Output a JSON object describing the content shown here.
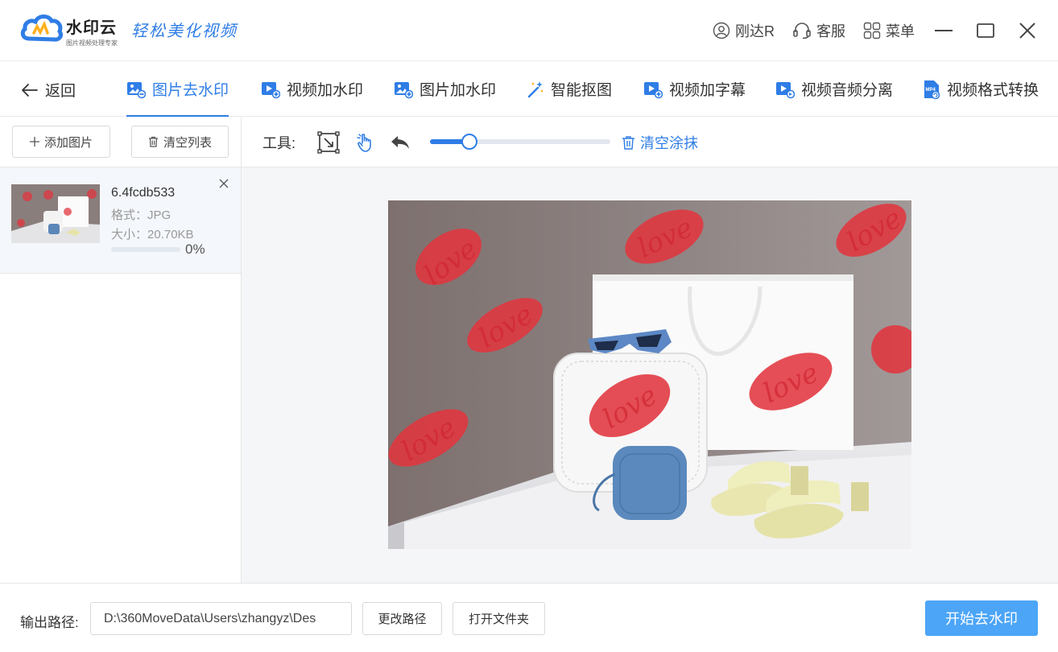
{
  "app": {
    "name": "水印云",
    "subtitle": "图片视频处理专家",
    "slogan": "轻松美化视频"
  },
  "top_actions": {
    "user": "刚达R",
    "service": "客服",
    "menu": "菜单"
  },
  "nav": {
    "back": "返回",
    "tabs": [
      {
        "label": "图片去水印",
        "icon": "image-remove-icon",
        "active": true
      },
      {
        "label": "视频加水印",
        "icon": "video-add-icon"
      },
      {
        "label": "图片加水印",
        "icon": "image-add-icon"
      },
      {
        "label": "智能抠图",
        "icon": "magic-wand-icon"
      },
      {
        "label": "视频加字幕",
        "icon": "video-subtitle-icon"
      },
      {
        "label": "视频音频分离",
        "icon": "video-audio-icon"
      },
      {
        "label": "视频格式转换",
        "icon": "mp4-convert-icon"
      }
    ]
  },
  "left": {
    "add_label": "添加图片",
    "clear_label": "清空列表",
    "file": {
      "name": "6.4fcdb533",
      "format": "格式：JPG",
      "size": "大小：20.70KB",
      "progress_text": "0%",
      "progress": 0.0
    }
  },
  "toolbar": {
    "label": "工具:",
    "brush_size": 0.22,
    "clear_label": "清空涂抹"
  },
  "canvas": {
    "watermark_text": "love"
  },
  "footer": {
    "output_label": "输出路径:",
    "output_path": "D:\\360MoveData\\Users\\zhangyz\\Des",
    "change_path": "更改路径",
    "open_folder": "打开文件夹",
    "start": "开始去水印"
  },
  "colors": {
    "accent": "#2f7de6",
    "start_button": "#4ca5f7",
    "watermark_paint": "#e8323c"
  }
}
